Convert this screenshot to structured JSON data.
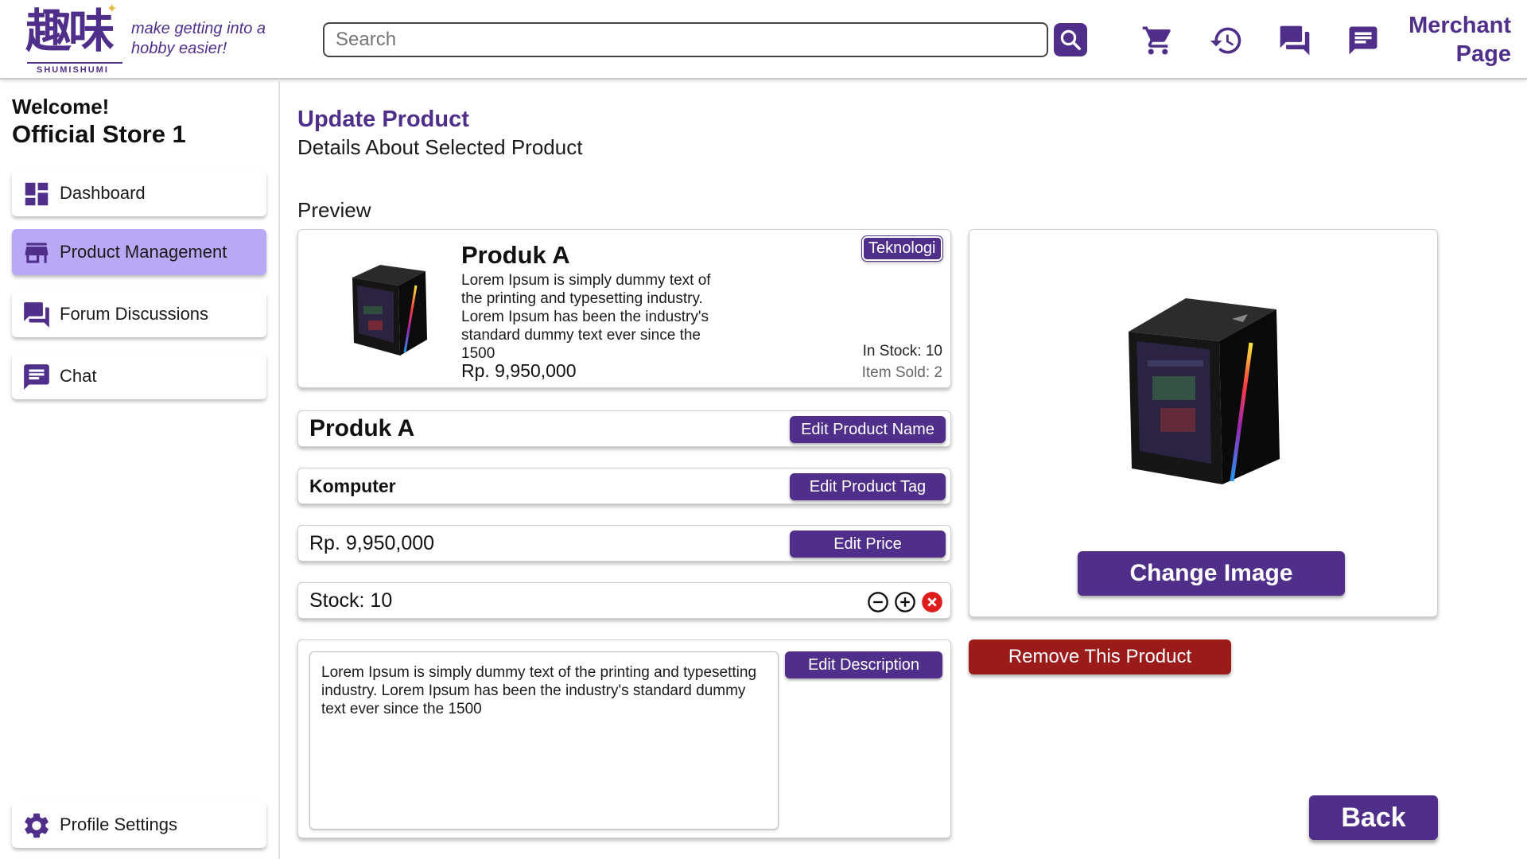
{
  "header": {
    "logo_kanji": "趣味",
    "logo_brand": "SHUMISHUMI",
    "tagline": "make getting into a hobby easier!",
    "search_placeholder": "Search",
    "merchant_line1": "Merchant",
    "merchant_line2": "Page",
    "icons": [
      "search-icon",
      "cart-icon",
      "history-icon",
      "forum-icon",
      "chat-icon"
    ]
  },
  "sidebar": {
    "welcome": "Welcome!",
    "store_name": "Official Store 1",
    "items": [
      {
        "label": "Dashboard",
        "icon": "dashboard-icon"
      },
      {
        "label": "Product Management",
        "icon": "store-icon"
      },
      {
        "label": "Forum Discussions",
        "icon": "forum-icon"
      },
      {
        "label": "Chat",
        "icon": "chat-icon"
      }
    ],
    "profile_settings": "Profile Settings"
  },
  "main": {
    "title": "Update Product",
    "subtitle": "Details About Selected Product",
    "preview_label": "Preview",
    "preview": {
      "name": "Produk A",
      "tag": "Teknologi",
      "description": "Lorem Ipsum is simply dummy text of the printing and typesetting industry. Lorem Ipsum has been the industry's standard dummy text ever since the 1500",
      "price": "Rp. 9,950,000",
      "stock": "In Stock: 10",
      "sold": "Item Sold: 2"
    },
    "fields": {
      "name": "Produk A",
      "name_btn": "Edit Product Name",
      "tag": "Komputer",
      "tag_btn": "Edit Product Tag",
      "price": "Rp. 9,950,000",
      "price_btn": "Edit Price",
      "stock": "Stock: 10",
      "description": "Lorem Ipsum is simply dummy text of the printing and typesetting industry. Lorem Ipsum has been the industry's standard dummy text ever since the 1500",
      "description_btn": "Edit Description"
    },
    "change_image_btn": "Change Image",
    "remove_btn": "Remove This Product",
    "back_btn": "Back"
  },
  "colors": {
    "brand": "#4f2f8a",
    "active_nav": "#b8a8f5",
    "danger": "#9b1b1b"
  }
}
